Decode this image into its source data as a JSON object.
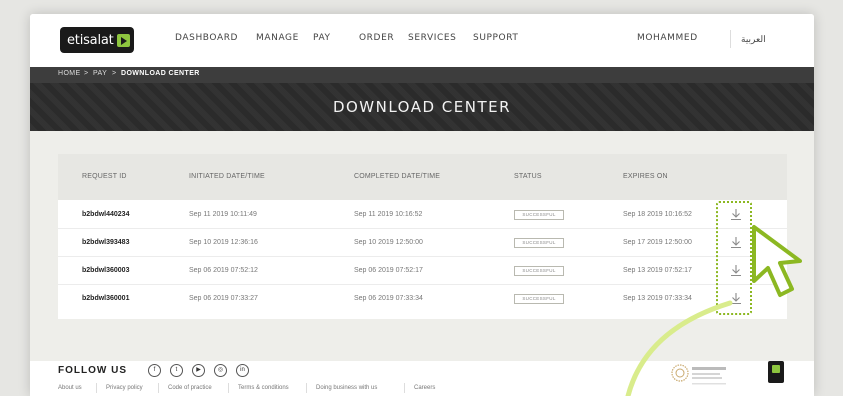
{
  "header": {
    "logo": "etisalat",
    "nav": [
      "DASHBOARD",
      "MANAGE",
      "PAY",
      "ORDER",
      "SERVICES",
      "SUPPORT"
    ],
    "user": "MOHAMMED",
    "language": "العربية"
  },
  "breadcrumb": [
    "HOME",
    ">",
    "PAY",
    ">",
    "DOWNLOAD CENTER"
  ],
  "page_title": "DOWNLOAD CENTER",
  "table": {
    "headers": [
      "REQUEST ID",
      "INITIATED DATE/TIME",
      "COMPLETED DATE/TIME",
      "STATUS",
      "EXPIRES ON"
    ],
    "rows": [
      {
        "id": "b2bdwl440234",
        "initiated": "Sep 11 2019 10:11:49",
        "completed": "Sep 11 2019 10:16:52",
        "status": "SUCCESSFUL",
        "expires": "Sep 18 2019 10:16:52"
      },
      {
        "id": "b2bdwl393483",
        "initiated": "Sep 10 2019 12:36:16",
        "completed": "Sep 10 2019 12:50:00",
        "status": "SUCCESSFUL",
        "expires": "Sep 17 2019 12:50:00"
      },
      {
        "id": "b2bdwl360003",
        "initiated": "Sep 06 2019 07:52:12",
        "completed": "Sep 06 2019 07:52:17",
        "status": "SUCCESSFUL",
        "expires": "Sep 13 2019 07:52:17"
      },
      {
        "id": "b2bdwl360001",
        "initiated": "Sep 06 2019 07:33:27",
        "completed": "Sep 06 2019 07:33:34",
        "status": "SUCCESSFUL",
        "expires": "Sep 13 2019 07:33:34"
      }
    ]
  },
  "footer": {
    "follow_label": "FOLLOW US",
    "social_icons": [
      "facebook-icon",
      "twitter-icon",
      "youtube-icon",
      "instagram-icon",
      "linkedin-icon"
    ],
    "social_glyphs": [
      "f",
      "t",
      "▶",
      "◎",
      "in"
    ],
    "links": [
      "About us",
      "Privacy policy",
      "Code of practice",
      "Terms & conditions",
      "Doing business with us",
      "Careers"
    ]
  },
  "colors": {
    "brand_green": "#8ec63f",
    "dark": "#2c2c2c",
    "highlight": "#8cb822",
    "arrow_fill": "#d9ec8c"
  }
}
